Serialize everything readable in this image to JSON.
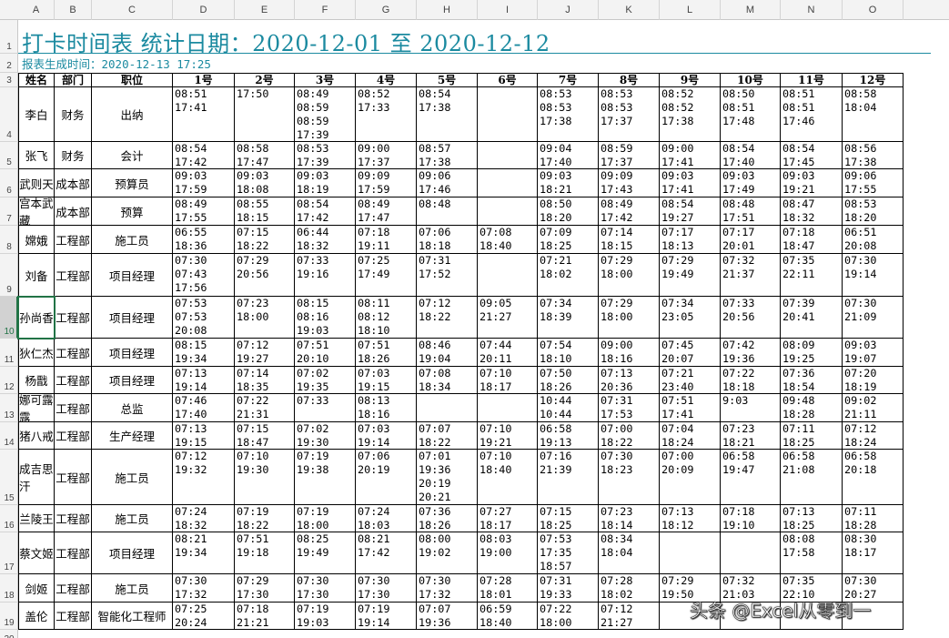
{
  "columns": [
    "A",
    "B",
    "C",
    "D",
    "E",
    "F",
    "G",
    "H",
    "I",
    "J",
    "K",
    "L",
    "M",
    "N",
    "O"
  ],
  "rows": [
    "1",
    "2",
    "3",
    "4",
    "5",
    "6",
    "7",
    "8",
    "9",
    "10",
    "11",
    "12",
    "13",
    "14",
    "15",
    "16",
    "17",
    "18",
    "19",
    "20"
  ],
  "selected_row": "10",
  "title": "打卡时间表 统计日期：2020-12-01 至 2020-12-12",
  "subtitle": "报表生成时间：2020-12-13 17:25",
  "headers": {
    "name": "姓名",
    "dept": "部门",
    "position": "职位",
    "days": [
      "1号",
      "2号",
      "3号",
      "4号",
      "5号",
      "6号",
      "7号",
      "8号",
      "9号",
      "10号",
      "11号",
      "12号"
    ]
  },
  "employees": [
    {
      "name": "李白",
      "dept": "财务",
      "position": "出纳",
      "times": [
        "08:51\n17:41",
        "17:50",
        "08:49\n08:59\n08:59\n17:39",
        "08:52\n17:33",
        "08:54\n17:38",
        "",
        "08:53\n08:53\n17:38",
        "08:53\n08:53\n17:37",
        "08:52\n08:52\n17:38",
        "08:50\n08:51\n17:48",
        "08:51\n08:51\n17:46",
        "08:58\n18:04"
      ]
    },
    {
      "name": "张飞",
      "dept": "财务",
      "position": "会计",
      "times": [
        "08:54\n17:42",
        "08:58\n17:47",
        "08:53\n17:39",
        "09:00\n17:37",
        "08:57\n17:38",
        "",
        "09:04\n17:40",
        "08:59\n17:37",
        "09:00\n17:41",
        "08:54\n17:40",
        "08:54\n17:45",
        "08:56\n17:38"
      ]
    },
    {
      "name": "武则天",
      "dept": "成本部",
      "position": "预算员",
      "times": [
        "09:03\n17:59",
        "09:03\n18:08",
        "09:03\n18:19",
        "09:09\n17:59",
        "09:06\n17:46",
        "",
        "09:03\n18:21",
        "09:09\n17:43",
        "09:03\n17:41",
        "09:03\n17:49",
        "09:03\n19:21",
        "09:06\n17:55"
      ]
    },
    {
      "name": "宫本武藏",
      "dept": "成本部",
      "position": "预算",
      "times": [
        "08:49\n17:55",
        "08:55\n18:15",
        "08:54\n17:42",
        "08:49\n17:47",
        "08:48",
        "",
        "08:50\n18:20",
        "08:49\n17:42",
        "08:54\n19:27",
        "08:48\n17:51",
        "08:47\n18:32",
        "08:53\n18:20"
      ]
    },
    {
      "name": "嫦娥",
      "dept": "工程部",
      "position": "施工员",
      "times": [
        "06:55\n18:36",
        "07:15\n18:22",
        "06:44\n18:32",
        "07:18\n19:11",
        "07:06\n18:18",
        "07:08\n18:40",
        "07:09\n18:25",
        "07:14\n18:15",
        "07:17\n18:13",
        "07:17\n20:01",
        "07:18\n18:47",
        "06:51\n20:08"
      ]
    },
    {
      "name": "刘备",
      "dept": "工程部",
      "position": "项目经理",
      "times": [
        "07:30\n07:43\n17:56",
        "07:29\n20:56",
        "07:33\n19:16",
        "07:25\n17:49",
        "07:31\n17:52",
        "",
        "07:21\n18:02",
        "07:29\n18:00",
        "07:29\n19:49",
        "07:32\n21:37",
        "07:35\n22:11",
        "07:30\n19:14"
      ]
    },
    {
      "name": "孙尚香",
      "dept": "工程部",
      "position": "项目经理",
      "times": [
        "07:53\n07:53\n20:08",
        "07:23\n18:00",
        "08:15\n08:16\n19:03",
        "08:11\n08:12\n18:10",
        "07:12\n18:22",
        "09:05\n21:27",
        "07:34\n18:39",
        "07:29\n18:00",
        "07:34\n23:05",
        "07:33\n20:56",
        "07:39\n20:41",
        "07:30\n21:09"
      ]
    },
    {
      "name": "狄仁杰",
      "dept": "工程部",
      "position": "项目经理",
      "times": [
        "08:15\n19:34",
        "07:12\n19:27",
        "07:51\n20:10",
        "07:51\n18:26",
        "08:46\n19:04",
        "07:44\n20:11",
        "07:54\n18:10",
        "09:00\n18:16",
        "07:45\n20:07",
        "07:42\n19:36",
        "08:09\n19:25",
        "09:03\n19:07"
      ]
    },
    {
      "name": "杨戬",
      "dept": "工程部",
      "position": "项目经理",
      "times": [
        "07:13\n19:14",
        "07:14\n18:35",
        "07:02\n19:35",
        "07:03\n19:15",
        "07:08\n18:34",
        "07:10\n18:17",
        "07:50\n18:26",
        "07:13\n20:36",
        "07:21\n23:40",
        "07:22\n18:18",
        "07:36\n18:54",
        "07:20\n18:19"
      ]
    },
    {
      "name": "娜可露露",
      "dept": "工程部",
      "position": "总监",
      "times": [
        "07:46\n17:40",
        "07:22\n21:31",
        "07:33",
        "08:13\n18:16",
        "",
        "",
        "10:44\n10:44",
        "07:31\n17:53",
        "07:51\n17:41",
        "9:03",
        "09:48\n18:28",
        "09:02\n21:11"
      ]
    },
    {
      "name": "猪八戒",
      "dept": "工程部",
      "position": "生产经理",
      "times": [
        "07:13\n19:15",
        "07:15\n18:47",
        "07:02\n19:30",
        "07:03\n19:14",
        "07:07\n18:22",
        "07:10\n19:21",
        "06:58\n19:13",
        "07:00\n18:22",
        "07:04\n18:24",
        "07:23\n18:21",
        "07:11\n18:25",
        "07:12\n18:24"
      ]
    },
    {
      "name": "成吉思汗",
      "dept": "工程部",
      "position": "施工员",
      "times": [
        "07:12\n19:32",
        "07:10\n19:30",
        "07:19\n19:38",
        "07:06\n20:19",
        "07:01\n19:36\n20:19\n20:21",
        "07:10\n18:40",
        "07:16\n21:39",
        "07:30\n18:23",
        "07:00\n20:09",
        "06:58\n19:47",
        "06:58\n21:08",
        "06:58\n20:18"
      ]
    },
    {
      "name": "兰陵王",
      "dept": "工程部",
      "position": "施工员",
      "times": [
        "07:24\n18:32",
        "07:19\n18:22",
        "07:19\n18:00",
        "07:24\n18:03",
        "07:36\n18:26",
        "07:27\n18:17",
        "07:15\n18:25",
        "07:23\n18:14",
        "07:13\n18:12",
        "07:18\n19:10",
        "07:13\n18:25",
        "07:11\n18:28"
      ]
    },
    {
      "name": "蔡文姬",
      "dept": "工程部",
      "position": "项目经理",
      "times": [
        "08:21\n19:34",
        "07:51\n19:18",
        "08:25\n19:49",
        "08:21\n17:42",
        "08:00\n19:02",
        "08:03\n19:00",
        "07:53\n17:35\n18:57",
        "08:34\n18:04",
        "",
        "",
        "08:08\n17:58",
        "08:30\n18:17"
      ]
    },
    {
      "name": "剑姬",
      "dept": "工程部",
      "position": "施工员",
      "times": [
        "07:30\n17:32",
        "07:29\n17:30",
        "07:30\n17:30",
        "07:30\n17:30",
        "07:30\n17:32",
        "07:28\n18:01",
        "07:31\n19:33",
        "07:28\n18:02",
        "07:29\n19:50",
        "07:32\n21:03",
        "07:35\n22:10",
        "07:30\n20:27"
      ]
    },
    {
      "name": "盖伦",
      "dept": "工程部",
      "position": "智能化工程师",
      "times": [
        "07:25\n20:24",
        "07:18\n21:21",
        "07:19\n19:03",
        "07:19\n19:14",
        "07:07\n19:36",
        "06:59\n18:40",
        "07:22\n18:00",
        "07:12\n21:27",
        "",
        "",
        "",
        ""
      ]
    }
  ],
  "watermark": "头条 @Excel从零到一"
}
